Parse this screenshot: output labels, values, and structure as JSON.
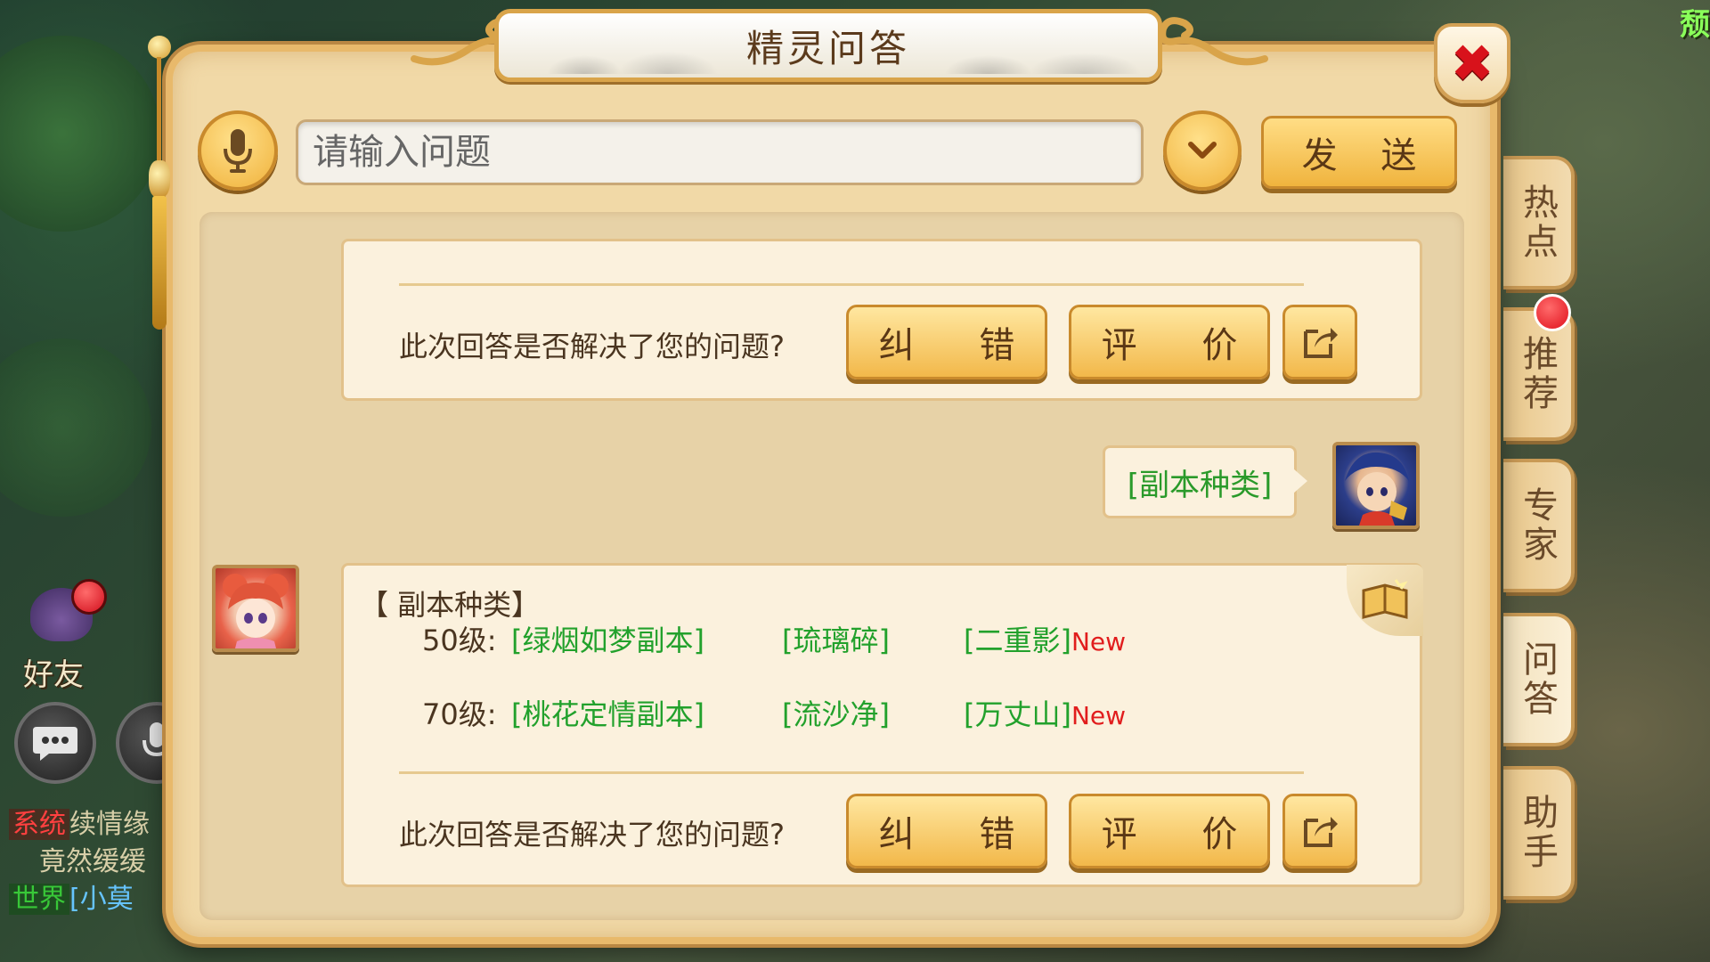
{
  "dialog": {
    "title": "精灵问答",
    "close_icon": "close-icon"
  },
  "input": {
    "placeholder": "请输入问题",
    "value": "",
    "send_label": "发 送"
  },
  "side_tabs": [
    {
      "label": "热点"
    },
    {
      "label": "推荐"
    },
    {
      "label": "专家"
    },
    {
      "label": "问答"
    },
    {
      "label": "助手"
    }
  ],
  "feedback": {
    "question": "此次回答是否解决了您的问题?",
    "fix_label": "纠 错",
    "rate_label": "评 价"
  },
  "user_message": "[副本种类]",
  "answer": {
    "heading": "【 副本种类】",
    "rows": [
      {
        "level": "50级:",
        "items": [
          "[绿烟如梦副本]",
          "[琉璃碎]",
          "[二重影]"
        ],
        "new": "New"
      },
      {
        "level": "70级:",
        "items": [
          "[桃花定情副本]",
          "[流沙净]",
          "[万丈山]"
        ],
        "new": "New"
      }
    ]
  },
  "hud": {
    "friend_label": "好友",
    "corner_text": "颓",
    "chat": [
      {
        "tag": "系统",
        "text": "续情缘"
      },
      {
        "tag": "",
        "text": "竟然缓缓"
      },
      {
        "tag": "世界",
        "text": "[小莫"
      }
    ]
  },
  "colors": {
    "accent_gold": "#f0b23c",
    "link_green": "#22a12c",
    "new_red": "#e11d1d",
    "close_red": "#d8121b"
  }
}
